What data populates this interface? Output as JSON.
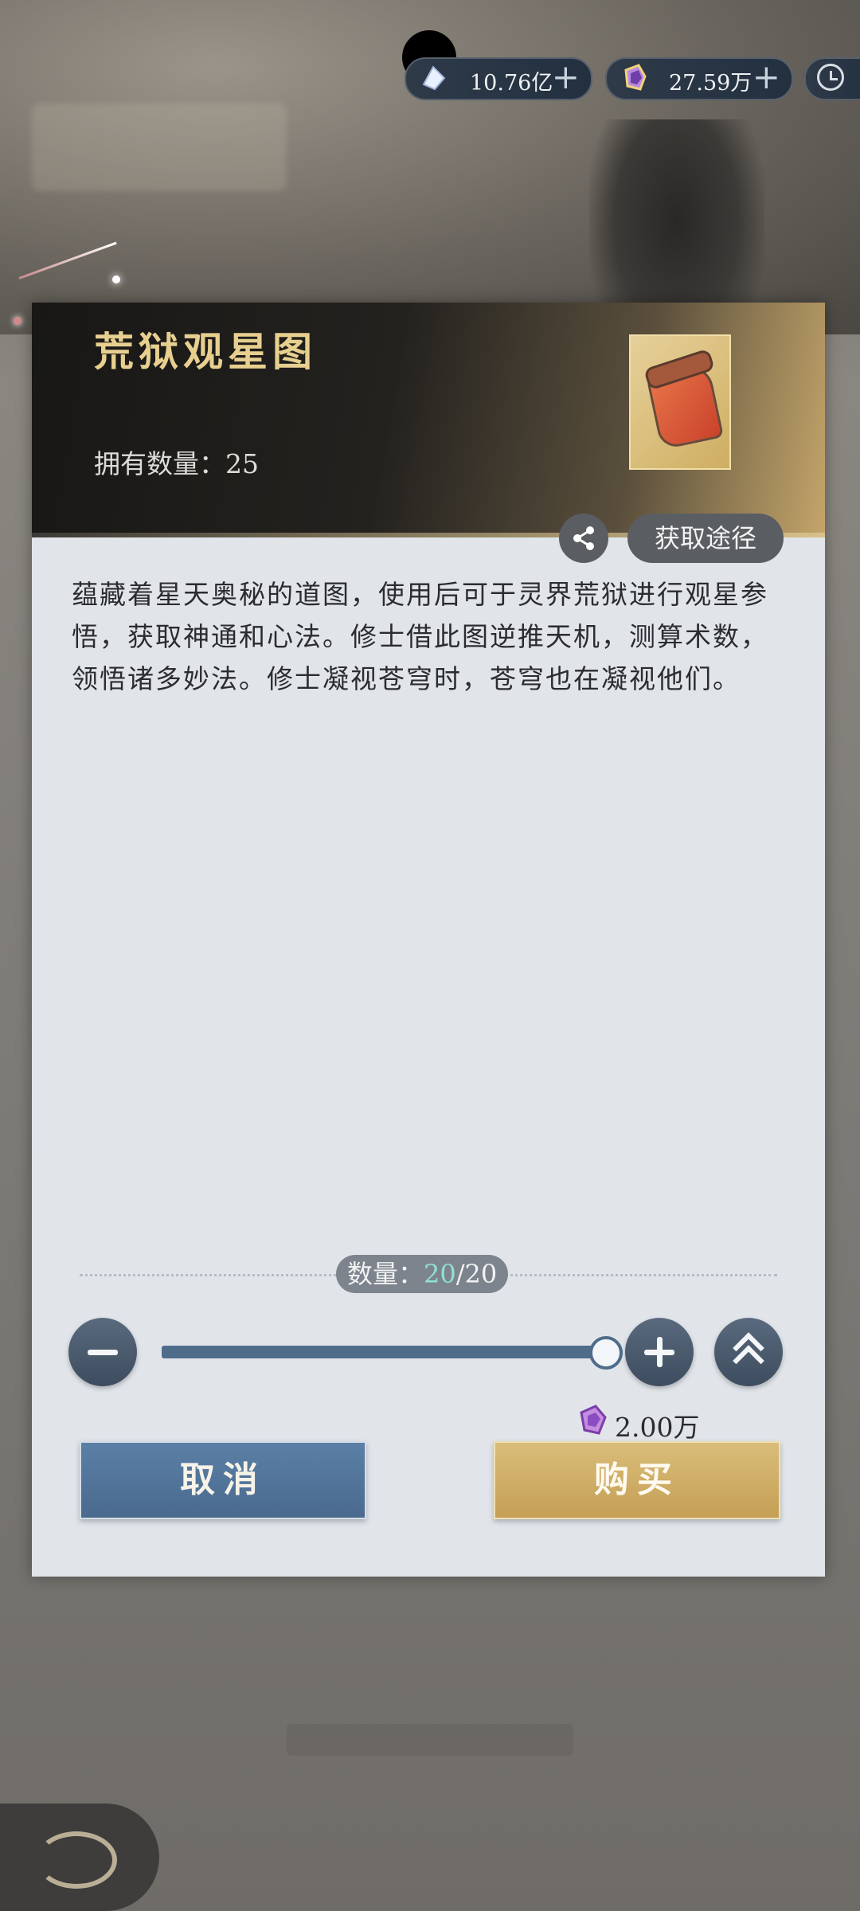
{
  "hud": {
    "currency_1": {
      "value": "10.76亿",
      "icon": "spirit-stone-icon"
    },
    "currency_2": {
      "value": "27.59万",
      "icon": "fairy-jade-icon"
    },
    "clock_icon": "clock-icon"
  },
  "dialog": {
    "title": "荒狱观星图",
    "owned_label": "拥有数量：",
    "owned_count": "25",
    "source_button": "获取途径",
    "description": "蕴藏着星天奥秘的道图，使用后可于灵界荒狱进行观星参悟，获取神通和心法。修士借此图逆推天机，测算术数，领悟诸多妙法。修士凝视苍穹时，苍穹也在凝视他们。",
    "quantity": {
      "label": "数量：",
      "current": "20",
      "separator": "/",
      "max": "20",
      "fraction": 1.0
    },
    "price": {
      "value": "2.00万",
      "icon": "fairy-jade-icon"
    },
    "cancel_button": "取消",
    "buy_button": "购买"
  },
  "colors": {
    "title_gold": "#e7cf8f",
    "cancel_blue": "#5b7fa6",
    "buy_gold": "#d9bd7a",
    "quantity_current": "#8fe1cf",
    "slider_fill": "#4f6d8a"
  }
}
